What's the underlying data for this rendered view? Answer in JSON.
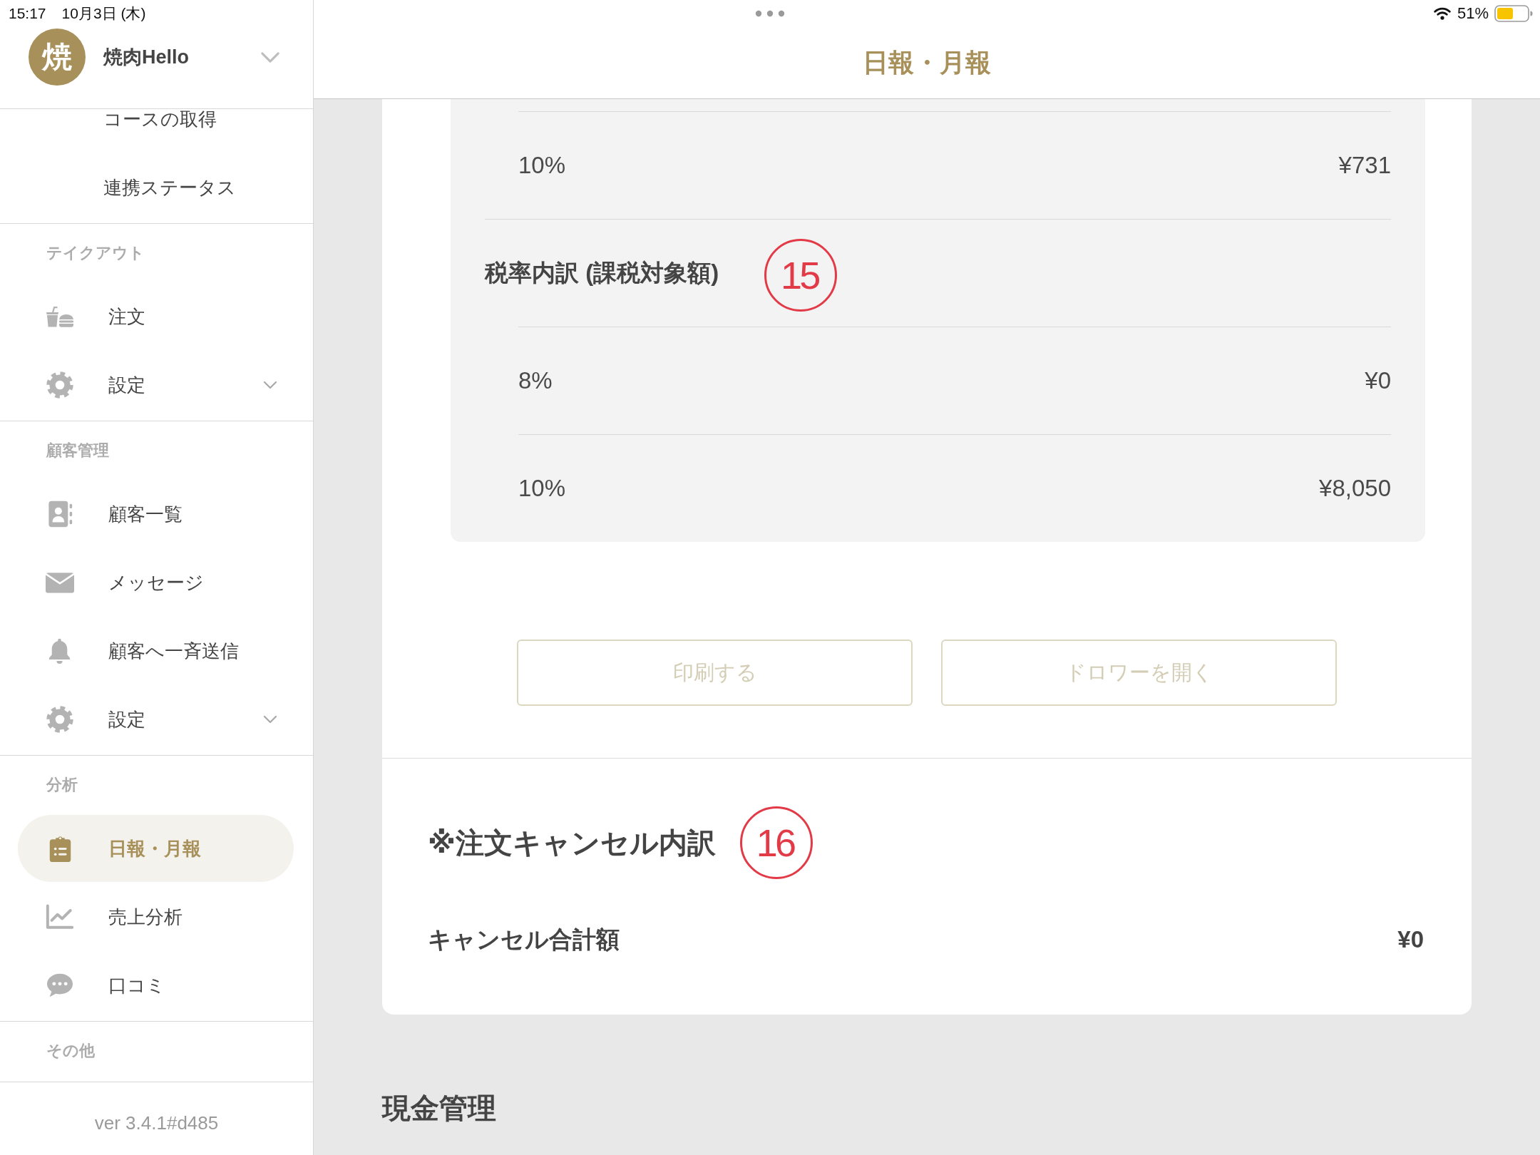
{
  "status_bar": {
    "time": "15:17",
    "date": "10月3日 (木)",
    "battery": "51%"
  },
  "sidebar": {
    "account": {
      "avatar": "焼",
      "name": "焼肉Hello",
      "expanded": false
    },
    "sections": [
      {
        "items": [
          {
            "kind": "sub",
            "label": "コースの取得",
            "selected": false
          },
          {
            "kind": "sub",
            "label": "連携ステータス",
            "selected": false
          }
        ]
      },
      {
        "header": "テイクアウト",
        "items": [
          {
            "kind": "order",
            "label": "注文",
            "selected": false
          },
          {
            "kind": "settings",
            "label": "設定",
            "selected": false,
            "expanded": false
          }
        ]
      },
      {
        "header": "顧客管理",
        "items": [
          {
            "kind": "customers",
            "label": "顧客一覧",
            "selected": false
          },
          {
            "kind": "messages",
            "label": "メッセージ",
            "selected": false
          },
          {
            "kind": "broadcast",
            "label": "顧客へ一斉送信",
            "selected": false
          },
          {
            "kind": "settings",
            "label": "設定",
            "selected": false,
            "expanded": false
          }
        ]
      },
      {
        "header": "分析",
        "items": [
          {
            "kind": "report",
            "label": "日報・月報",
            "selected": true
          },
          {
            "kind": "sales",
            "label": "売上分析",
            "selected": false
          },
          {
            "kind": "reviews",
            "label": "口コミ",
            "selected": false
          }
        ]
      },
      {
        "header": "その他"
      }
    ],
    "version": "ver 3.4.1#d485"
  },
  "header": {
    "title": "日報・月報"
  },
  "tax_panel": {
    "groups": [
      {
        "rows": [
          {
            "label": "10%",
            "amount": "¥731"
          }
        ]
      },
      {
        "title": "税率内訳 (課税対象額)",
        "marker": "15",
        "rows": [
          {
            "label": "8%",
            "amount": "¥0"
          },
          {
            "label": "10%",
            "amount": "¥8,050"
          }
        ]
      }
    ]
  },
  "actions": [
    {
      "label": "印刷する",
      "disabled": true
    },
    {
      "label": "ドロワーを開く",
      "disabled": true
    }
  ],
  "cancellations": {
    "title": "※注文キャンセル内訳",
    "marker": "16",
    "rows": [
      {
        "label": "キャンセル合計額",
        "amount": "¥0"
      }
    ]
  },
  "next_section": {
    "title": "現金管理"
  }
}
